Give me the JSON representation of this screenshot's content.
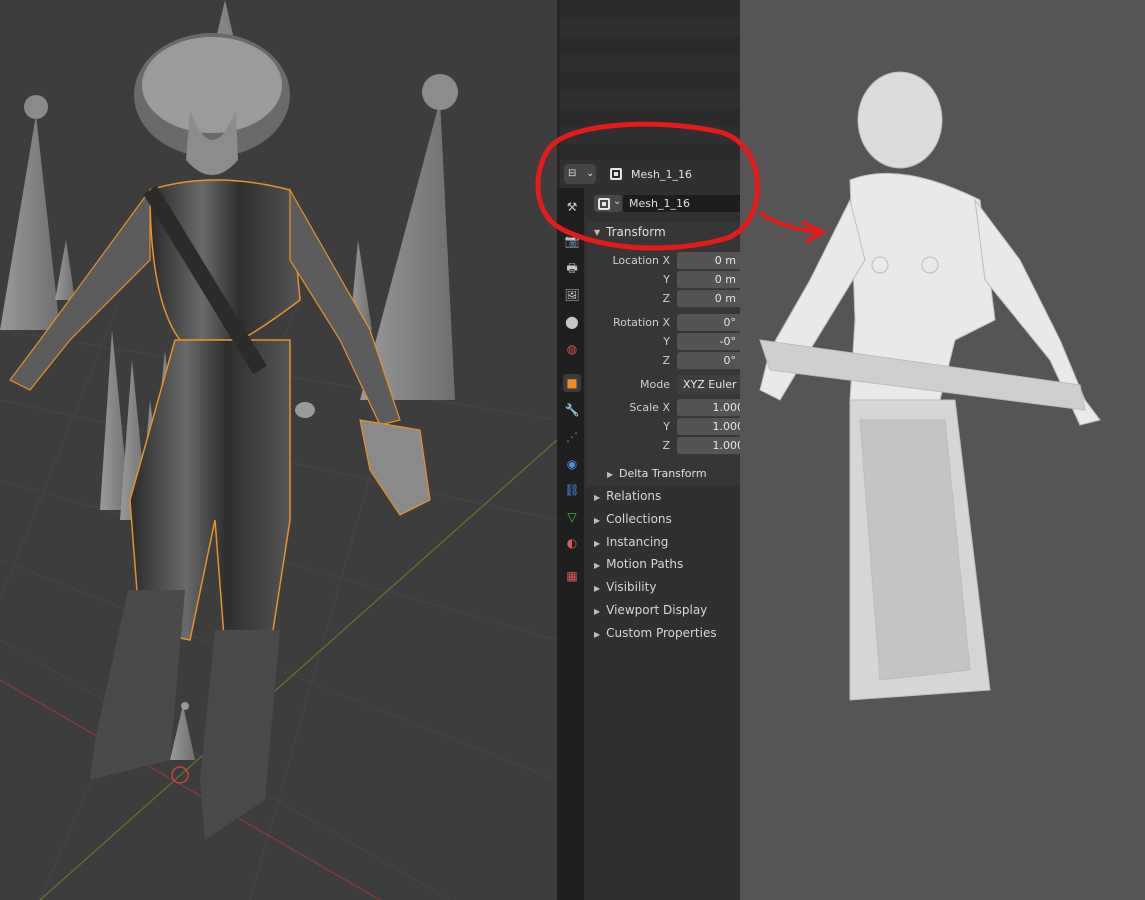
{
  "header": {
    "object_name": "Mesh_1_16"
  },
  "object_data": {
    "name": "Mesh_1_16"
  },
  "tabs": [
    {
      "name": "tool-tab-icon",
      "glyph": "⚒",
      "color": "#c8c8c8"
    },
    {
      "name": "render-tab-icon",
      "glyph": "📷",
      "color": "#c8c8c8"
    },
    {
      "name": "output-tab-icon",
      "glyph": "🖶",
      "color": "#c8c8c8"
    },
    {
      "name": "view-layer-tab-icon",
      "glyph": "🖼",
      "color": "#c8c8c8"
    },
    {
      "name": "scene-tab-icon",
      "glyph": "⬤",
      "color": "#c8c8c8"
    },
    {
      "name": "world-tab-icon",
      "glyph": "◍",
      "color": "#d94e4e"
    },
    {
      "name": "object-tab-icon",
      "glyph": "■",
      "color": "#f08a24"
    },
    {
      "name": "modifier-tab-icon",
      "glyph": "🔧",
      "color": "#4a8ee6"
    },
    {
      "name": "particles-tab-icon",
      "glyph": "⋰",
      "color": "#4a8ee6"
    },
    {
      "name": "physics-tab-icon",
      "glyph": "◉",
      "color": "#4a8ee6"
    },
    {
      "name": "constraints-tab-icon",
      "glyph": "⛓",
      "color": "#4a8ee6"
    },
    {
      "name": "data-tab-icon",
      "glyph": "▽",
      "color": "#3fc35a"
    },
    {
      "name": "material-tab-icon",
      "glyph": "◐",
      "color": "#e05a5a"
    },
    {
      "name": "texture-tab-icon",
      "glyph": "▦",
      "color": "#e05a5a"
    }
  ],
  "transform": {
    "title": "Transform",
    "location_label": "Location X",
    "location": {
      "x": "0 m",
      "y_label": "Y",
      "y": "0 m",
      "z_label": "Z",
      "z": "0 m"
    },
    "rotation_label": "Rotation X",
    "rotation": {
      "x": "0°",
      "y_label": "Y",
      "y": "-0°",
      "z_label": "Z",
      "z": "0°"
    },
    "mode_label": "Mode",
    "mode_value": "XYZ Euler",
    "scale_label": "Scale X",
    "scale": {
      "x": "1.000",
      "y_label": "Y",
      "y": "1.000",
      "z_label": "Z",
      "z": "1.000"
    },
    "delta_label": "Delta Transform"
  },
  "panels": [
    "Relations",
    "Collections",
    "Instancing",
    "Motion Paths",
    "Visibility",
    "Viewport Display",
    "Custom Properties"
  ],
  "colors": {
    "annotation": "#e31b1b",
    "selection_outline": "#e8902a"
  }
}
